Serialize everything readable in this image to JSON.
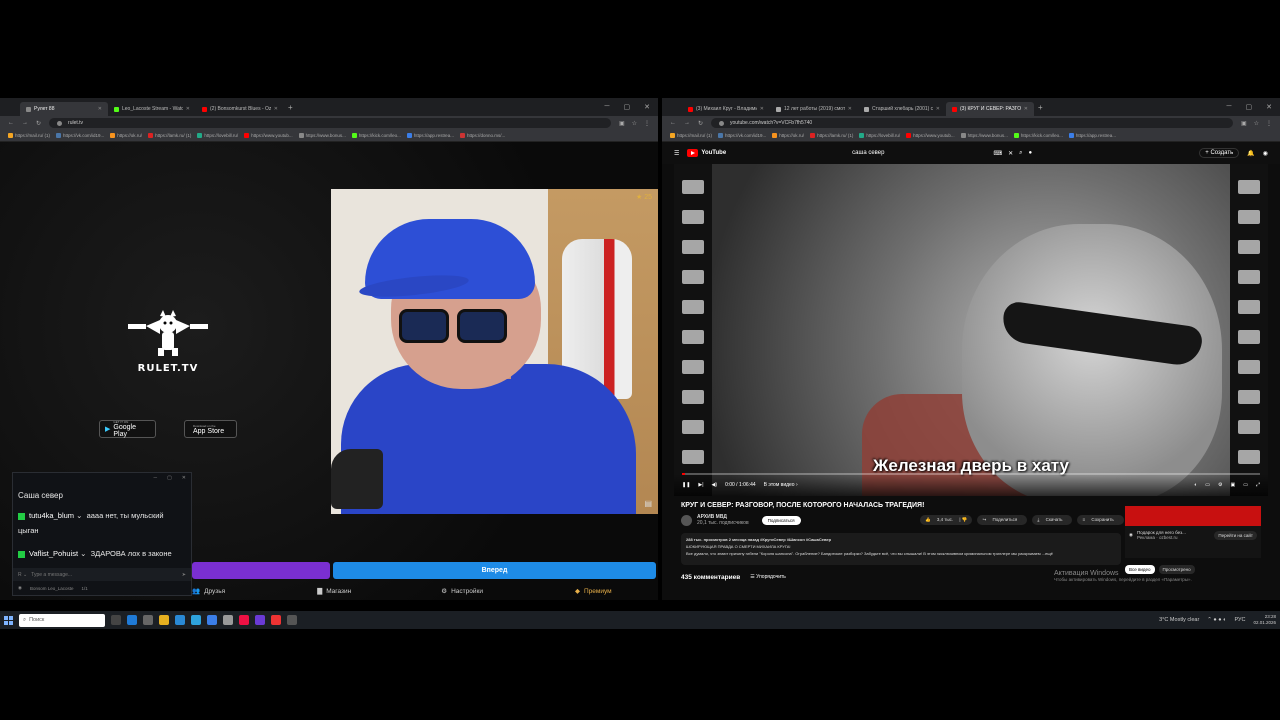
{
  "left_window": {
    "tabs": [
      {
        "label": "Рулет 88",
        "active": true
      },
      {
        "label": "Leo_Lacoste Stream - Watch Li",
        "active": false
      },
      {
        "label": "(2) Bonsomkurst Blues - Ozzie",
        "active": false
      }
    ],
    "url": "rulet.tv",
    "bookmarks": [
      "https://mail.ru/ (1)",
      "https://vk.com/id19...",
      "https://ok.ru/",
      "https://lamk.ru/ (1)",
      "https://lovebill.ru/",
      "https://www.youtub...",
      "https://www.bonus...",
      "https://kick.com/leo...",
      "https://app.restrea...",
      "https://donno.ms/..."
    ],
    "site_name": "RULET.TV",
    "google_play": {
      "small": "GET IT ON",
      "label": "Google Play"
    },
    "app_store": {
      "small": "Download on the",
      "label": "App Store"
    },
    "chat": {
      "title": "Саша север",
      "messages": [
        {
          "user": "tutu4ka_blum",
          "text": "аааа нет, ты мульский цыган"
        },
        {
          "user": "Vaflist_Pohuist",
          "text": "ЗДАРОВА лох в законе"
        }
      ],
      "input_placeholder": "Type a message...",
      "footer_user": "Bonsom Leo_Lacoste",
      "footer_count": "1/1"
    },
    "blue_button": "Вперед",
    "footer_nav": [
      "Друзья",
      "Магазин",
      "Настройки",
      "Премиум"
    ]
  },
  "right_window": {
    "tabs": [
      {
        "label": "(3) Михаил Круг - Владимирск",
        "active": false
      },
      {
        "label": "12 лет работы (2019) смотре",
        "active": false
      },
      {
        "label": "Старший хлебарь (2001) смотр",
        "active": false
      },
      {
        "label": "(3) КРУГ И СЕВЕР: РАЗГОВ",
        "active": true
      }
    ],
    "url": "youtube.com/watch?v=VCFb7fh5740",
    "bookmarks": [
      "https://mail.ru/ (1)",
      "https://vk.com/id19...",
      "https://ok.ru/",
      "https://lamk.ru/ (1)",
      "https://lovebill.ru/",
      "https://www.youtub...",
      "https://www.bonus...",
      "https://kick.com/leo...",
      "https://app.restrea..."
    ],
    "yt_logo": "YouTube",
    "search_query": "саша север",
    "create_label": "Создать",
    "subtitle": "Железная дверь в хату",
    "time": "0:00 / 1:06:44",
    "chapter": "В этом видео ›",
    "progress": 0.005,
    "video_title": "КРУГ И СЕВЕР: РАЗГОВОР, ПОСЛЕ КОТОРОГО НАЧАЛАСЬ ТРАГЕДИЯ!",
    "channel": "АРХИВ МВД",
    "subs": "20,1 тыс. подписчиков",
    "subscribe": "Подписаться",
    "likes": "3,4 тыс.",
    "share": "Поделиться",
    "download": "Скачать",
    "save": "Сохранить",
    "desc_line1": "288 тыс. просмотров  2 месяца назад  #КругиСевер #Шансон #СашаСевер",
    "desc_line2": "ШОКИРУЮЩАЯ ПРАВДА О СМЕРТИ МИХАИЛА КРУГА!",
    "desc_line3": "Все думали, что знают причину гибели \"Короля шансона\". Ограбление? Бандитские разборки? Забудьте всё, что вы слышали! В этом эксклюзивном криминальном триллере мы раскрываем ...ещё",
    "comments": "435 комментариев",
    "sort": "Упорядочить",
    "ad_title": "Подарок для него без...",
    "ad_source": "Реклама · ozbest.ru",
    "ad_cta": "Перейти на сайт",
    "chips": [
      "Все видео",
      "Просмотрено"
    ],
    "activate_title": "Активация Windows",
    "activate_sub": "Чтобы активировать Windows, перейдите в раздел «Параметры»."
  },
  "taskbar": {
    "search": "Поиск",
    "weather": "3°C  Mostly clear",
    "lang": "РУС",
    "time": "23:28",
    "date": "02.01.2026"
  }
}
